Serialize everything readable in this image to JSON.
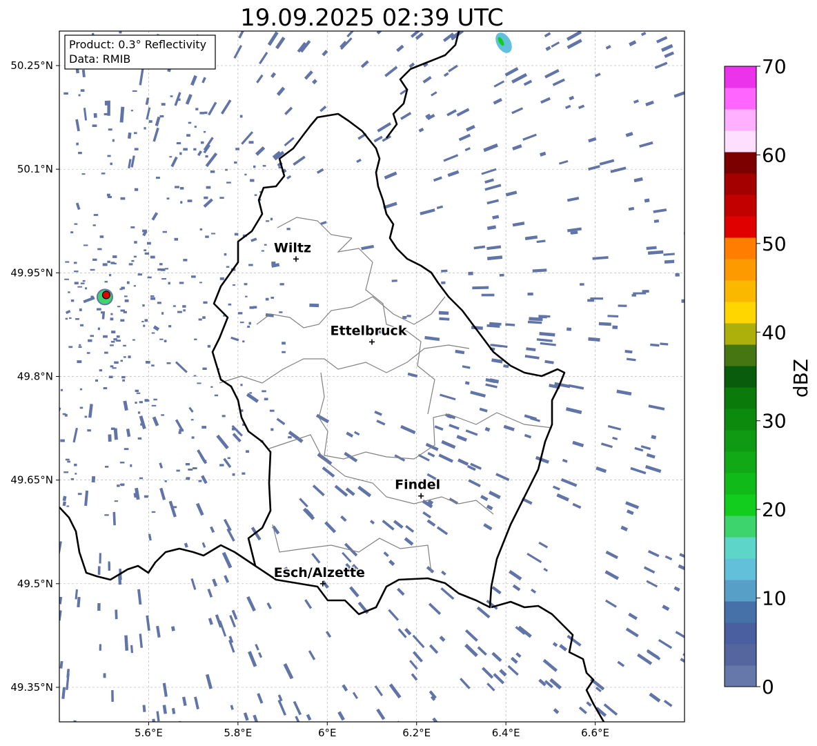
{
  "title": "19.09.2025 02:39 UTC",
  "info_box": {
    "product": "Product: 0.3° Reflectivity",
    "source": "Data: RMIB"
  },
  "map": {
    "lon_range": [
      5.4,
      6.8
    ],
    "lat_range": [
      49.3,
      50.3
    ],
    "x_ticks": [
      {
        "value": 5.6,
        "label": "5.6°E"
      },
      {
        "value": 5.8,
        "label": "5.8°E"
      },
      {
        "value": 6.0,
        "label": "6°E"
      },
      {
        "value": 6.2,
        "label": "6.2°E"
      },
      {
        "value": 6.4,
        "label": "6.4°E"
      },
      {
        "value": 6.6,
        "label": "6.6°E"
      }
    ],
    "y_ticks": [
      {
        "value": 50.25,
        "label": "50.25°N"
      },
      {
        "value": 50.1,
        "label": "50.1°N"
      },
      {
        "value": 49.95,
        "label": "49.95°N"
      },
      {
        "value": 49.8,
        "label": "49.8°N"
      },
      {
        "value": 49.65,
        "label": "49.65°N"
      },
      {
        "value": 49.5,
        "label": "49.5°N"
      },
      {
        "value": 49.35,
        "label": "49.35°N"
      }
    ],
    "grid": true,
    "cities": [
      {
        "name": "Wiltz",
        "lon": 5.93,
        "lat": 49.97
      },
      {
        "name": "Ettelbruck",
        "lon": 6.1,
        "lat": 49.85
      },
      {
        "name": "Findel",
        "lon": 6.21,
        "lat": 49.627
      },
      {
        "name": "Esch/Alzette",
        "lon": 5.99,
        "lat": 49.5
      }
    ],
    "radar_site": {
      "lon": 5.505,
      "lat": 49.918,
      "color": "#e00000"
    },
    "echo_color": "#6074a8"
  },
  "colorbar": {
    "label": "dBZ",
    "min": 0,
    "max": 70,
    "ticks": [
      0,
      10,
      20,
      30,
      40,
      50,
      60,
      70
    ],
    "colors": [
      "#6677aa",
      "#55669f",
      "#4a5fa0",
      "#4670a8",
      "#589fc8",
      "#62c0da",
      "#5dd5c8",
      "#3dd46e",
      "#12cc1e",
      "#10bb19",
      "#11aa16",
      "#0e9a12",
      "#0b8a0e",
      "#0a7a0b",
      "#095c0c",
      "#457612",
      "#adaf0a",
      "#ffd600",
      "#fbb800",
      "#fd9a00",
      "#ff7d00",
      "#e00000",
      "#c30000",
      "#a50000",
      "#7b0000",
      "#ffdfff",
      "#ffb0ff",
      "#ff66ff",
      "#ea33ea"
    ]
  }
}
